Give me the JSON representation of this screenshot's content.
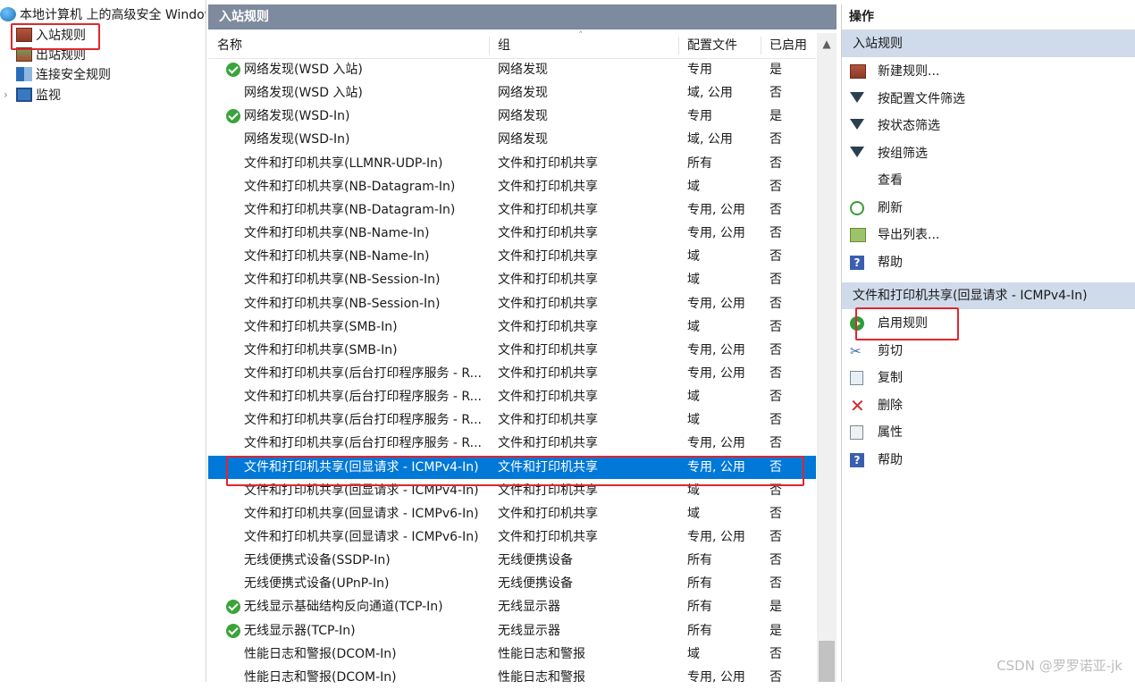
{
  "tree": {
    "root_label": "本地计算机 上的高级安全 Windows",
    "items": [
      {
        "label": "入站规则",
        "icon": "inbound-wall-icon",
        "expander": ""
      },
      {
        "label": "出站规则",
        "icon": "outbound-wall-icon",
        "expander": ""
      },
      {
        "label": "连接安全规则",
        "icon": "connection-security-icon",
        "expander": ""
      },
      {
        "label": "监视",
        "icon": "monitor-icon",
        "expander": "›"
      }
    ]
  },
  "center": {
    "title": "入站规则",
    "columns": {
      "name": "名称",
      "group": "组",
      "profile": "配置文件",
      "enabled": "已启用"
    },
    "sort_indicator": "˄",
    "rows": [
      {
        "name": "网络发现(WSD 入站)",
        "group": "网络发现",
        "profile": "专用",
        "enabled": "是",
        "on": true
      },
      {
        "name": "网络发现(WSD 入站)",
        "group": "网络发现",
        "profile": "域, 公用",
        "enabled": "否",
        "on": false
      },
      {
        "name": "网络发现(WSD-In)",
        "group": "网络发现",
        "profile": "专用",
        "enabled": "是",
        "on": true
      },
      {
        "name": "网络发现(WSD-In)",
        "group": "网络发现",
        "profile": "域, 公用",
        "enabled": "否",
        "on": false
      },
      {
        "name": "文件和打印机共享(LLMNR-UDP-In)",
        "group": "文件和打印机共享",
        "profile": "所有",
        "enabled": "否",
        "on": false
      },
      {
        "name": "文件和打印机共享(NB-Datagram-In)",
        "group": "文件和打印机共享",
        "profile": "域",
        "enabled": "否",
        "on": false
      },
      {
        "name": "文件和打印机共享(NB-Datagram-In)",
        "group": "文件和打印机共享",
        "profile": "专用, 公用",
        "enabled": "否",
        "on": false
      },
      {
        "name": "文件和打印机共享(NB-Name-In)",
        "group": "文件和打印机共享",
        "profile": "专用, 公用",
        "enabled": "否",
        "on": false
      },
      {
        "name": "文件和打印机共享(NB-Name-In)",
        "group": "文件和打印机共享",
        "profile": "域",
        "enabled": "否",
        "on": false
      },
      {
        "name": "文件和打印机共享(NB-Session-In)",
        "group": "文件和打印机共享",
        "profile": "域",
        "enabled": "否",
        "on": false
      },
      {
        "name": "文件和打印机共享(NB-Session-In)",
        "group": "文件和打印机共享",
        "profile": "专用, 公用",
        "enabled": "否",
        "on": false
      },
      {
        "name": "文件和打印机共享(SMB-In)",
        "group": "文件和打印机共享",
        "profile": "域",
        "enabled": "否",
        "on": false
      },
      {
        "name": "文件和打印机共享(SMB-In)",
        "group": "文件和打印机共享",
        "profile": "专用, 公用",
        "enabled": "否",
        "on": false
      },
      {
        "name": "文件和打印机共享(后台打印程序服务 - R...",
        "group": "文件和打印机共享",
        "profile": "专用, 公用",
        "enabled": "否",
        "on": false
      },
      {
        "name": "文件和打印机共享(后台打印程序服务 - R...",
        "group": "文件和打印机共享",
        "profile": "域",
        "enabled": "否",
        "on": false
      },
      {
        "name": "文件和打印机共享(后台打印程序服务 - R...",
        "group": "文件和打印机共享",
        "profile": "域",
        "enabled": "否",
        "on": false
      },
      {
        "name": "文件和打印机共享(后台打印程序服务 - R...",
        "group": "文件和打印机共享",
        "profile": "专用, 公用",
        "enabled": "否",
        "on": false
      },
      {
        "name": "文件和打印机共享(回显请求 - ICMPv4-In)",
        "group": "文件和打印机共享",
        "profile": "专用, 公用",
        "enabled": "否",
        "on": false,
        "selected": true
      },
      {
        "name": "文件和打印机共享(回显请求 - ICMPv4-In)",
        "group": "文件和打印机共享",
        "profile": "域",
        "enabled": "否",
        "on": false
      },
      {
        "name": "文件和打印机共享(回显请求 - ICMPv6-In)",
        "group": "文件和打印机共享",
        "profile": "域",
        "enabled": "否",
        "on": false
      },
      {
        "name": "文件和打印机共享(回显请求 - ICMPv6-In)",
        "group": "文件和打印机共享",
        "profile": "专用, 公用",
        "enabled": "否",
        "on": false
      },
      {
        "name": "无线便携式设备(SSDP-In)",
        "group": "无线便携设备",
        "profile": "所有",
        "enabled": "否",
        "on": false
      },
      {
        "name": "无线便携式设备(UPnP-In)",
        "group": "无线便携设备",
        "profile": "所有",
        "enabled": "否",
        "on": false
      },
      {
        "name": "无线显示基础结构反向通道(TCP-In)",
        "group": "无线显示器",
        "profile": "所有",
        "enabled": "是",
        "on": true
      },
      {
        "name": "无线显示器(TCP-In)",
        "group": "无线显示器",
        "profile": "所有",
        "enabled": "是",
        "on": true
      },
      {
        "name": "性能日志和警报(DCOM-In)",
        "group": "性能日志和警报",
        "profile": "域",
        "enabled": "否",
        "on": false
      },
      {
        "name": "性能日志和警报(DCOM-In)",
        "group": "性能日志和警报",
        "profile": "专用, 公用",
        "enabled": "否",
        "on": false
      }
    ]
  },
  "actions": {
    "header": "操作",
    "section1": "入站规则",
    "section1_items": [
      {
        "label": "新建规则...",
        "icon": "new-rule-icon"
      },
      {
        "label": "按配置文件筛选",
        "icon": "filter-icon"
      },
      {
        "label": "按状态筛选",
        "icon": "filter-icon"
      },
      {
        "label": "按组筛选",
        "icon": "filter-icon"
      },
      {
        "label": "查看",
        "icon": ""
      },
      {
        "label": "刷新",
        "icon": "refresh-icon"
      },
      {
        "label": "导出列表...",
        "icon": "export-icon"
      },
      {
        "label": "帮助",
        "icon": "help-icon"
      }
    ],
    "section2": "文件和打印机共享(回显请求 - ICMPv4-In)",
    "section2_items": [
      {
        "label": "启用规则",
        "icon": "enable-rule-icon"
      },
      {
        "label": "剪切",
        "icon": "cut-icon"
      },
      {
        "label": "复制",
        "icon": "copy-icon"
      },
      {
        "label": "删除",
        "icon": "delete-icon"
      },
      {
        "label": "属性",
        "icon": "properties-icon"
      },
      {
        "label": "帮助",
        "icon": "help-icon"
      }
    ]
  },
  "watermark": "CSDN @罗罗诺亚-jk",
  "colors": {
    "selection": "#0078d7",
    "title_bar": "#7e8a9d",
    "section_bar": "#cfdbea",
    "annotation": "#e0262f",
    "enabled_check": "#3aa43a"
  }
}
